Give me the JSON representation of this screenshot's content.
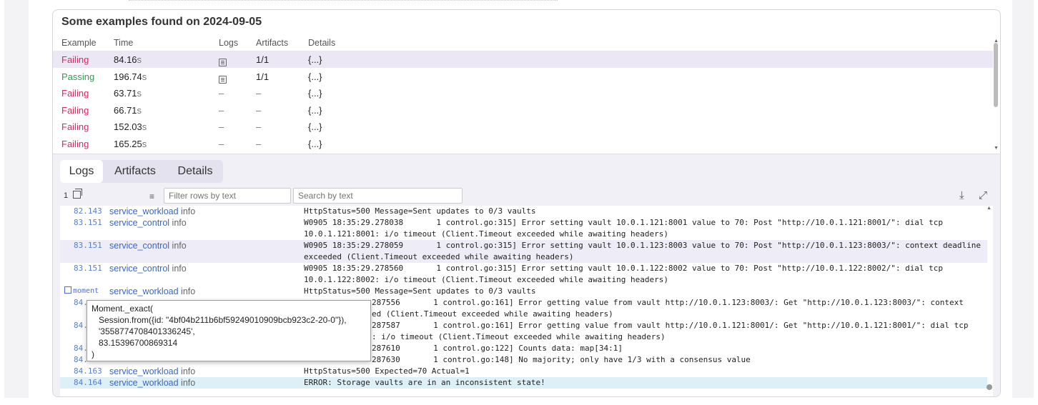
{
  "examples": {
    "title": "Some examples found on 2024-09-05",
    "columns": [
      "Example",
      "Time",
      "Logs",
      "Artifacts",
      "Details"
    ],
    "rows": [
      {
        "status": "Failing",
        "time": "84.16s",
        "logs": "icon",
        "artifacts": "1/1",
        "details": "{...}"
      },
      {
        "status": "Passing",
        "time": "196.74s",
        "logs": "icon",
        "artifacts": "1/1",
        "details": "{...}"
      },
      {
        "status": "Failing",
        "time": "63.71s",
        "logs": "–",
        "artifacts": "–",
        "details": "{...}"
      },
      {
        "status": "Failing",
        "time": "66.71s",
        "logs": "–",
        "artifacts": "–",
        "details": "{...}"
      },
      {
        "status": "Failing",
        "time": "152.03s",
        "logs": "–",
        "artifacts": "–",
        "details": "{...}"
      },
      {
        "status": "Failing",
        "time": "165.25s",
        "logs": "–",
        "artifacts": "–",
        "details": "{...}"
      }
    ]
  },
  "tabs": [
    "Logs",
    "Artifacts",
    "Details"
  ],
  "active_tab": "Logs",
  "toolbar": {
    "count": "1",
    "filter_placeholder": "Filter rows by text",
    "search_placeholder": "Search by text"
  },
  "logs": [
    {
      "time": "82.143",
      "service": "service_workload",
      "level": "info",
      "message": "HttpStatus=500 Message=Sent updates to 0/3 vaults",
      "style": "plain"
    },
    {
      "time": "83.151",
      "service": "service_control",
      "level": "info",
      "message": "W0905 18:35:29.278038       1 control.go:315] Error setting vault 10.0.1.121:8001 value to 70: Post \"http://10.0.1.121:8001/\": dial tcp\n10.0.1.121:8001: i/o timeout (Client.Timeout exceeded while awaiting headers)",
      "style": "plain"
    },
    {
      "time": "83.151",
      "service": "service_control",
      "level": "info",
      "message": "W0905 18:35:29.278059       1 control.go:315] Error setting vault 10.0.1.123:8003 value to 70: Post \"http://10.0.1.123:8003/\": context deadline\nexceeded (Client.Timeout exceeded while awaiting headers)",
      "style": "alt"
    },
    {
      "time": "83.151",
      "service": "service_control",
      "level": "info",
      "message": "W0905 18:35:29.278560       1 control.go:315] Error setting vault 10.0.1.122:8002 value to 70: Post \"http://10.0.1.122:8002/\": dial tcp\n10.0.1.122:8002: i/o timeout (Client.Timeout exceeded while awaiting headers)",
      "style": "plain"
    },
    {
      "time": "moment",
      "service": "service_workload",
      "level": "info",
      "message": "HttpStatus=500 Message=Sent updates to 0/3 vaults",
      "style": "plain"
    },
    {
      "time": "84.",
      "service": "",
      "level": "",
      "message": "287556       1 control.go:161] Error getting value from vault http://10.0.1.123:8003/: Get \"http://10.0.1.123:8003/\": context\ned (Client.Timeout exceeded while awaiting headers)",
      "style": "plain"
    },
    {
      "time": "84.",
      "service": "",
      "level": "",
      "message": "287587       1 control.go:161] Error getting value from vault http://10.0.1.121:8001/: Get \"http://10.0.1.121:8001/\": dial tcp\n: i/o timeout (Client.Timeout exceeded while awaiting headers)",
      "style": "plain"
    },
    {
      "time": "84.",
      "service": "",
      "level": "",
      "message": "287610       1 control.go:122] Counts data: map[34:1]",
      "style": "plain"
    },
    {
      "time": "84.",
      "service": "",
      "level": "",
      "message": "287630       1 control.go:148] No majority; only have 1/3 with a consensus value",
      "style": "plain"
    },
    {
      "time": "84.163",
      "service": "service_workload",
      "level": "info",
      "message": "HttpStatus=500 Expected=70 Actual=1",
      "style": "plain"
    },
    {
      "time": "84.164",
      "service": "service_workload",
      "level": "info",
      "message": "ERROR: Storage vaults are in an inconsistent state!",
      "style": "err"
    }
  ],
  "tooltip": {
    "lines": [
      "Moment._exact(",
      "   Session.from({id: \"4bf04b211b6bf59249010909bcb923c2-20-0\"}),",
      "   '3558774708401336245',",
      "   83.15396700869314",
      ")"
    ]
  }
}
